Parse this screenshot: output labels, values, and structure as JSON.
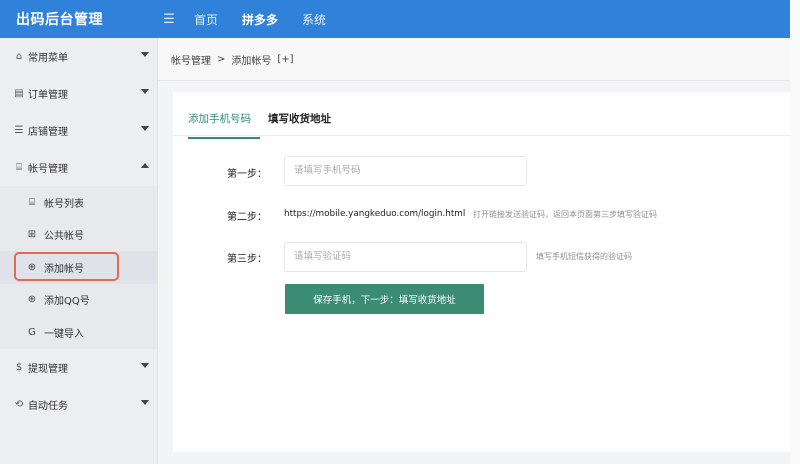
{
  "topbar": {
    "title": "出码后台管理",
    "collapse_icon": "menu-fold-icon",
    "nav": [
      {
        "label": "首页"
      },
      {
        "label": "拼多多"
      },
      {
        "label": "系统"
      }
    ],
    "accent_color": "#2f81d9"
  },
  "sidebar": {
    "items": [
      {
        "label": "常用菜单",
        "icon": "home-icon"
      },
      {
        "label": "订单管理",
        "icon": "database-icon"
      },
      {
        "label": "店铺管理",
        "icon": "list-icon"
      },
      {
        "label": "帐号管理",
        "icon": "account-icon"
      },
      {
        "label": "提现管理",
        "icon": "withdraw-icon"
      },
      {
        "label": "自动任务",
        "icon": "task-icon"
      }
    ],
    "subitems": [
      {
        "label": "帐号列表",
        "icon": "account-list-icon"
      },
      {
        "label": "公共帐号",
        "icon": "public-account-icon"
      },
      {
        "label": "添加帐号",
        "icon": "add-circle-icon"
      },
      {
        "label": "添加QQ号",
        "icon": "add-circle-icon"
      },
      {
        "label": "一键导入",
        "icon": "import-icon"
      }
    ],
    "highlight_color": "#e06a55"
  },
  "breadcrumb": {
    "parent": "帐号管理",
    "separator": ">",
    "current": "添加帐号",
    "extra": "[+]"
  },
  "main": {
    "tabs": [
      {
        "label": "添加手机号码"
      },
      {
        "label": "填写收货地址"
      }
    ],
    "steps": {
      "step1_label": "第一步：",
      "step1_placeholder": "请填写手机号码",
      "step2_label": "第二步：",
      "step2_url": "https://mobile.yangkeduo.com/login.html",
      "step2_hint": "打开链接发送验证码，返回本页面第三步填写验证码",
      "step3_label": "第三步：",
      "step3_placeholder": "请填写验证码",
      "step3_hint": "填写手机短信获得的验证码"
    },
    "submit_label": "保存手机，下一步：填写收货地址",
    "submit_color": "#3a8d72"
  }
}
